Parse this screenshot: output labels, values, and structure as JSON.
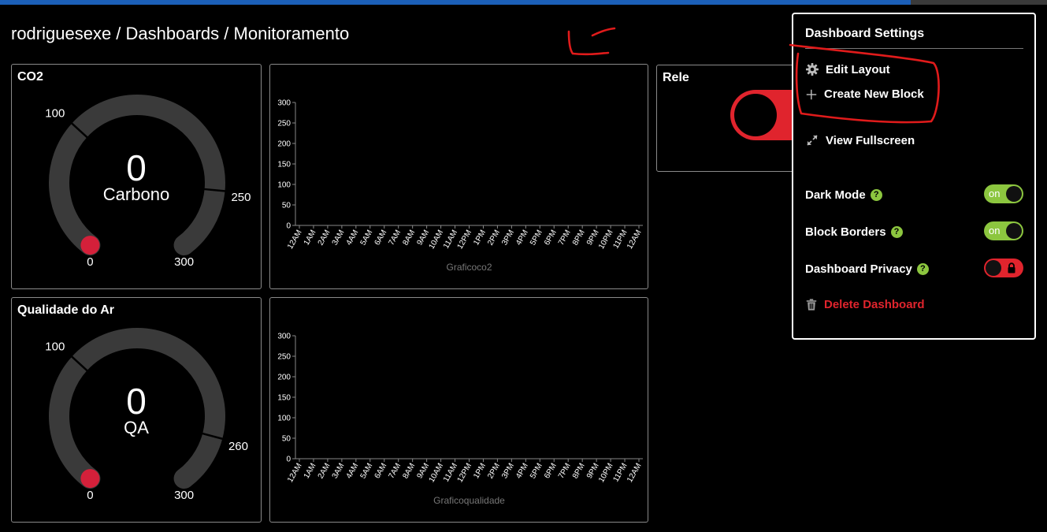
{
  "progress": {
    "fraction": 0.87,
    "color": "#1b5fb8"
  },
  "breadcrumb": {
    "user": "rodriguesexe",
    "section": "Dashboards",
    "page": "Monitoramento",
    "separator": " / "
  },
  "blocks": {
    "co2": {
      "title": "CO2",
      "value": "0",
      "label": "Carbono",
      "min": "0",
      "max": "300",
      "tick_low": "100",
      "tick_high": "250",
      "low_value": 100,
      "high_value": 250,
      "max_value": 300
    },
    "air": {
      "title": "Qualidade do Ar",
      "value": "0",
      "label": "QA",
      "min": "0",
      "max": "300",
      "tick_low": "100",
      "tick_high": "260",
      "low_value": 100,
      "high_value": 260,
      "max_value": 300
    },
    "relay": {
      "title": "Rele",
      "state": "off"
    }
  },
  "chart_data": [
    {
      "type": "line",
      "title": "",
      "xlabel": "Graficoco2",
      "ylabel": "",
      "ylim": [
        0,
        300
      ],
      "yticks": [
        "0",
        "50",
        "100",
        "150",
        "200",
        "250",
        "300"
      ],
      "x": [
        "12AM",
        "1AM",
        "2AM",
        "3AM",
        "4AM",
        "5AM",
        "6AM",
        "7AM",
        "8AM",
        "9AM",
        "10AM",
        "11AM",
        "12PM",
        "1PM",
        "2PM",
        "3PM",
        "4PM",
        "5PM",
        "6PM",
        "7PM",
        "8PM",
        "9PM",
        "10PM",
        "11PM",
        "12AM"
      ],
      "series": []
    },
    {
      "type": "line",
      "title": "",
      "xlabel": "Graficoqualidade",
      "ylabel": "",
      "ylim": [
        0,
        300
      ],
      "yticks": [
        "0",
        "50",
        "100",
        "150",
        "200",
        "250",
        "300"
      ],
      "x": [
        "12AM",
        "1AM",
        "2AM",
        "3AM",
        "4AM",
        "5AM",
        "6AM",
        "7AM",
        "8AM",
        "9AM",
        "10AM",
        "11AM",
        "12PM",
        "1PM",
        "2PM",
        "3PM",
        "4PM",
        "5PM",
        "6PM",
        "7PM",
        "8PM",
        "9PM",
        "10PM",
        "11PM",
        "12AM"
      ],
      "series": []
    }
  ],
  "settings": {
    "title": "Dashboard Settings",
    "edit_layout": "Edit Layout",
    "create_block": "Create New Block",
    "view_fullscreen": "View Fullscreen",
    "dark_mode": {
      "label": "Dark Mode",
      "help": "?",
      "state": "on"
    },
    "block_borders": {
      "label": "Block Borders",
      "help": "?",
      "state": "on"
    },
    "privacy": {
      "label": "Dashboard Privacy",
      "help": "?",
      "state": "locked"
    },
    "delete": "Delete Dashboard"
  },
  "colors": {
    "accent_green": "#8cc63f",
    "danger_red": "#e0242d",
    "gauge_track": "#3a3a3a",
    "gauge_dot": "#d4203a",
    "annotation": "#e01b1b"
  },
  "icons": {
    "edit_layout": "gear-icon",
    "create_block": "plus-icon",
    "fullscreen": "expand-icon",
    "delete": "trash-icon",
    "privacy": "lock-icon"
  }
}
